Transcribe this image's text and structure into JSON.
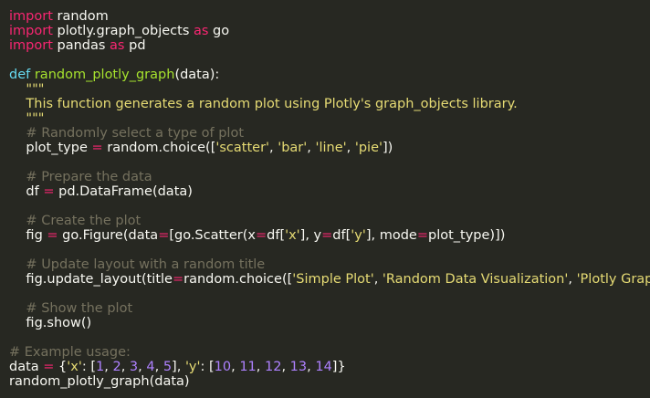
{
  "lines": [
    [
      {
        "t": "import",
        "k": "kw"
      },
      {
        "t": " random",
        "k": "txt"
      }
    ],
    [
      {
        "t": "import",
        "k": "kw"
      },
      {
        "t": " plotly.graph_objects ",
        "k": "txt"
      },
      {
        "t": "as",
        "k": "kw"
      },
      {
        "t": " go",
        "k": "txt"
      }
    ],
    [
      {
        "t": "import",
        "k": "kw"
      },
      {
        "t": " pandas ",
        "k": "txt"
      },
      {
        "t": "as",
        "k": "kw"
      },
      {
        "t": " pd",
        "k": "txt"
      }
    ],
    [],
    [
      {
        "t": "def",
        "k": "def"
      },
      {
        "t": " random_plotly_graph",
        "k": "fn"
      },
      {
        "t": "(data):",
        "k": "txt"
      }
    ],
    [
      {
        "t": "    \"\"\"",
        "k": "doc"
      }
    ],
    [
      {
        "t": "    This function generates a random plot using Plotly's graph_objects library.",
        "k": "doc"
      }
    ],
    [
      {
        "t": "    \"\"\"",
        "k": "doc"
      }
    ],
    [
      {
        "t": "    # Randomly select a type of plot",
        "k": "cmt"
      }
    ],
    [
      {
        "t": "    plot_type ",
        "k": "txt"
      },
      {
        "t": "=",
        "k": "op"
      },
      {
        "t": " random.choice([",
        "k": "txt"
      },
      {
        "t": "'scatter'",
        "k": "str"
      },
      {
        "t": ", ",
        "k": "txt"
      },
      {
        "t": "'bar'",
        "k": "str"
      },
      {
        "t": ", ",
        "k": "txt"
      },
      {
        "t": "'line'",
        "k": "str"
      },
      {
        "t": ", ",
        "k": "txt"
      },
      {
        "t": "'pie'",
        "k": "str"
      },
      {
        "t": "])",
        "k": "txt"
      }
    ],
    [],
    [
      {
        "t": "    # Prepare the data",
        "k": "cmt"
      }
    ],
    [
      {
        "t": "    df ",
        "k": "txt"
      },
      {
        "t": "=",
        "k": "op"
      },
      {
        "t": " pd.DataFrame(data)",
        "k": "txt"
      }
    ],
    [],
    [
      {
        "t": "    # Create the plot",
        "k": "cmt"
      }
    ],
    [
      {
        "t": "    fig ",
        "k": "txt"
      },
      {
        "t": "=",
        "k": "op"
      },
      {
        "t": " go.Figure(data",
        "k": "txt"
      },
      {
        "t": "=",
        "k": "op"
      },
      {
        "t": "[go.Scatter(x",
        "k": "txt"
      },
      {
        "t": "=",
        "k": "op"
      },
      {
        "t": "df[",
        "k": "txt"
      },
      {
        "t": "'x'",
        "k": "str"
      },
      {
        "t": "], y",
        "k": "txt"
      },
      {
        "t": "=",
        "k": "op"
      },
      {
        "t": "df[",
        "k": "txt"
      },
      {
        "t": "'y'",
        "k": "str"
      },
      {
        "t": "], mode",
        "k": "txt"
      },
      {
        "t": "=",
        "k": "op"
      },
      {
        "t": "plot_type)])",
        "k": "txt"
      }
    ],
    [],
    [
      {
        "t": "    # Update layout with a random title",
        "k": "cmt"
      }
    ],
    [
      {
        "t": "    fig.update_layout(title",
        "k": "txt"
      },
      {
        "t": "=",
        "k": "op"
      },
      {
        "t": "random.choice([",
        "k": "txt"
      },
      {
        "t": "'Simple Plot'",
        "k": "str"
      },
      {
        "t": ", ",
        "k": "txt"
      },
      {
        "t": "'Random Data Visualization'",
        "k": "str"
      },
      {
        "t": ", ",
        "k": "txt"
      },
      {
        "t": "'Plotly Graph'",
        "k": "str"
      },
      {
        "t": "]))",
        "k": "txt"
      }
    ],
    [],
    [
      {
        "t": "    # Show the plot",
        "k": "cmt"
      }
    ],
    [
      {
        "t": "    fig.show()",
        "k": "txt"
      }
    ],
    [],
    [
      {
        "t": "# Example usage:",
        "k": "cmt"
      }
    ],
    [
      {
        "t": "data ",
        "k": "txt"
      },
      {
        "t": "=",
        "k": "op"
      },
      {
        "t": " {",
        "k": "txt"
      },
      {
        "t": "'x'",
        "k": "str"
      },
      {
        "t": ": [",
        "k": "txt"
      },
      {
        "t": "1",
        "k": "num"
      },
      {
        "t": ", ",
        "k": "txt"
      },
      {
        "t": "2",
        "k": "num"
      },
      {
        "t": ", ",
        "k": "txt"
      },
      {
        "t": "3",
        "k": "num"
      },
      {
        "t": ", ",
        "k": "txt"
      },
      {
        "t": "4",
        "k": "num"
      },
      {
        "t": ", ",
        "k": "txt"
      },
      {
        "t": "5",
        "k": "num"
      },
      {
        "t": "], ",
        "k": "txt"
      },
      {
        "t": "'y'",
        "k": "str"
      },
      {
        "t": ": [",
        "k": "txt"
      },
      {
        "t": "10",
        "k": "num"
      },
      {
        "t": ", ",
        "k": "txt"
      },
      {
        "t": "11",
        "k": "num"
      },
      {
        "t": ", ",
        "k": "txt"
      },
      {
        "t": "12",
        "k": "num"
      },
      {
        "t": ", ",
        "k": "txt"
      },
      {
        "t": "13",
        "k": "num"
      },
      {
        "t": ", ",
        "k": "txt"
      },
      {
        "t": "14",
        "k": "num"
      },
      {
        "t": "]}",
        "k": "txt"
      }
    ],
    [
      {
        "t": "random_plotly_graph(data)",
        "k": "txt"
      }
    ]
  ],
  "colors": {
    "background": "#272822",
    "keyword": "#f92672",
    "def": "#66d9ef",
    "function": "#a6e22e",
    "string": "#e6db74",
    "number": "#ae81ff",
    "comment": "#75715e",
    "text": "#f8f8f2"
  }
}
